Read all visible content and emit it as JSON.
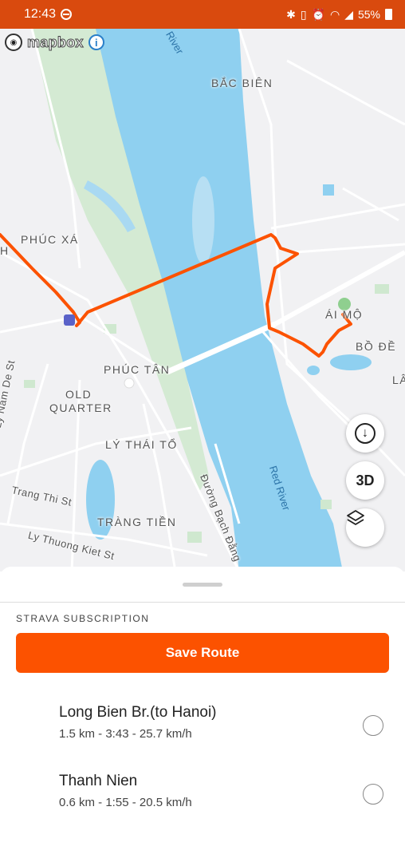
{
  "status_bar": {
    "time": "12:43",
    "battery": "55%",
    "bg_color": "#d94a0e"
  },
  "map": {
    "attribution": "mapbox",
    "info_icon": "info-icon",
    "labels": {
      "bac_bien": "BẮC BIÊN",
      "phuc_xa": "PHÚC XÁ",
      "phuc_tan": "PHÚC TÂN",
      "old_quarter_1": "OLD",
      "old_quarter_2": "QUARTER",
      "ly_thai_to": "LÝ THÁI TỔ",
      "trang_tien": "TRÀNG TIỀN",
      "ai_mo": "ÁI MỘ",
      "bo_de": "BỒ ĐỀ",
      "trang_thi": "Trang Thi St",
      "ly_thuong_kiet": "Ly Thuong Kiet St",
      "nam_de": "Ly Nam De St",
      "bach_dang": "Đường Bạch Đằng",
      "red_river": "Red River",
      "river_top": "River",
      "edge_h": "H",
      "edge_la": "LÂ"
    },
    "buttons": {
      "download_icon": "download-icon",
      "three_d": "3D",
      "layers_icon": "layers-icon"
    },
    "route_color": "#fc5200",
    "river_color": "#8fd0f0",
    "park_color": "#cfe8cf"
  },
  "sheet": {
    "subscription_label": "STRAVA SUBSCRIPTION",
    "save_button": "Save Route",
    "accent": "#fc5200",
    "segments": [
      {
        "name": "Long Bien Br.(to Hanoi)",
        "stats": "1.5 km - 3:43 - 25.7 km/h"
      },
      {
        "name": "Thanh Nien",
        "stats": "0.6 km - 1:55 - 20.5 km/h"
      }
    ]
  }
}
